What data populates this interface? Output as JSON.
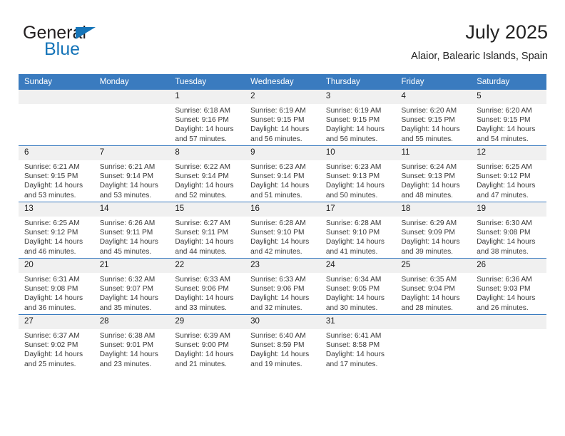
{
  "brand": {
    "word_one": "General",
    "word_two": "Blue"
  },
  "header": {
    "title": "July 2025",
    "subtitle": "Alaior, Balearic Islands, Spain"
  },
  "weekday_headers": [
    "Sunday",
    "Monday",
    "Tuesday",
    "Wednesday",
    "Thursday",
    "Friday",
    "Saturday"
  ],
  "colors": {
    "header_blue": "#3a7bbf",
    "daynum_bg": "#f0f0f0",
    "brand_blue": "#1574b8",
    "text": "#3a3a3a"
  },
  "weeks": [
    [
      {
        "day": "",
        "sunrise": "",
        "sunset": "",
        "daylight_a": "",
        "daylight_b": ""
      },
      {
        "day": "",
        "sunrise": "",
        "sunset": "",
        "daylight_a": "",
        "daylight_b": ""
      },
      {
        "day": "1",
        "sunrise": "Sunrise: 6:18 AM",
        "sunset": "Sunset: 9:16 PM",
        "daylight_a": "Daylight: 14 hours",
        "daylight_b": "and 57 minutes."
      },
      {
        "day": "2",
        "sunrise": "Sunrise: 6:19 AM",
        "sunset": "Sunset: 9:15 PM",
        "daylight_a": "Daylight: 14 hours",
        "daylight_b": "and 56 minutes."
      },
      {
        "day": "3",
        "sunrise": "Sunrise: 6:19 AM",
        "sunset": "Sunset: 9:15 PM",
        "daylight_a": "Daylight: 14 hours",
        "daylight_b": "and 56 minutes."
      },
      {
        "day": "4",
        "sunrise": "Sunrise: 6:20 AM",
        "sunset": "Sunset: 9:15 PM",
        "daylight_a": "Daylight: 14 hours",
        "daylight_b": "and 55 minutes."
      },
      {
        "day": "5",
        "sunrise": "Sunrise: 6:20 AM",
        "sunset": "Sunset: 9:15 PM",
        "daylight_a": "Daylight: 14 hours",
        "daylight_b": "and 54 minutes."
      }
    ],
    [
      {
        "day": "6",
        "sunrise": "Sunrise: 6:21 AM",
        "sunset": "Sunset: 9:15 PM",
        "daylight_a": "Daylight: 14 hours",
        "daylight_b": "and 53 minutes."
      },
      {
        "day": "7",
        "sunrise": "Sunrise: 6:21 AM",
        "sunset": "Sunset: 9:14 PM",
        "daylight_a": "Daylight: 14 hours",
        "daylight_b": "and 53 minutes."
      },
      {
        "day": "8",
        "sunrise": "Sunrise: 6:22 AM",
        "sunset": "Sunset: 9:14 PM",
        "daylight_a": "Daylight: 14 hours",
        "daylight_b": "and 52 minutes."
      },
      {
        "day": "9",
        "sunrise": "Sunrise: 6:23 AM",
        "sunset": "Sunset: 9:14 PM",
        "daylight_a": "Daylight: 14 hours",
        "daylight_b": "and 51 minutes."
      },
      {
        "day": "10",
        "sunrise": "Sunrise: 6:23 AM",
        "sunset": "Sunset: 9:13 PM",
        "daylight_a": "Daylight: 14 hours",
        "daylight_b": "and 50 minutes."
      },
      {
        "day": "11",
        "sunrise": "Sunrise: 6:24 AM",
        "sunset": "Sunset: 9:13 PM",
        "daylight_a": "Daylight: 14 hours",
        "daylight_b": "and 48 minutes."
      },
      {
        "day": "12",
        "sunrise": "Sunrise: 6:25 AM",
        "sunset": "Sunset: 9:12 PM",
        "daylight_a": "Daylight: 14 hours",
        "daylight_b": "and 47 minutes."
      }
    ],
    [
      {
        "day": "13",
        "sunrise": "Sunrise: 6:25 AM",
        "sunset": "Sunset: 9:12 PM",
        "daylight_a": "Daylight: 14 hours",
        "daylight_b": "and 46 minutes."
      },
      {
        "day": "14",
        "sunrise": "Sunrise: 6:26 AM",
        "sunset": "Sunset: 9:11 PM",
        "daylight_a": "Daylight: 14 hours",
        "daylight_b": "and 45 minutes."
      },
      {
        "day": "15",
        "sunrise": "Sunrise: 6:27 AM",
        "sunset": "Sunset: 9:11 PM",
        "daylight_a": "Daylight: 14 hours",
        "daylight_b": "and 44 minutes."
      },
      {
        "day": "16",
        "sunrise": "Sunrise: 6:28 AM",
        "sunset": "Sunset: 9:10 PM",
        "daylight_a": "Daylight: 14 hours",
        "daylight_b": "and 42 minutes."
      },
      {
        "day": "17",
        "sunrise": "Sunrise: 6:28 AM",
        "sunset": "Sunset: 9:10 PM",
        "daylight_a": "Daylight: 14 hours",
        "daylight_b": "and 41 minutes."
      },
      {
        "day": "18",
        "sunrise": "Sunrise: 6:29 AM",
        "sunset": "Sunset: 9:09 PM",
        "daylight_a": "Daylight: 14 hours",
        "daylight_b": "and 39 minutes."
      },
      {
        "day": "19",
        "sunrise": "Sunrise: 6:30 AM",
        "sunset": "Sunset: 9:08 PM",
        "daylight_a": "Daylight: 14 hours",
        "daylight_b": "and 38 minutes."
      }
    ],
    [
      {
        "day": "20",
        "sunrise": "Sunrise: 6:31 AM",
        "sunset": "Sunset: 9:08 PM",
        "daylight_a": "Daylight: 14 hours",
        "daylight_b": "and 36 minutes."
      },
      {
        "day": "21",
        "sunrise": "Sunrise: 6:32 AM",
        "sunset": "Sunset: 9:07 PM",
        "daylight_a": "Daylight: 14 hours",
        "daylight_b": "and 35 minutes."
      },
      {
        "day": "22",
        "sunrise": "Sunrise: 6:33 AM",
        "sunset": "Sunset: 9:06 PM",
        "daylight_a": "Daylight: 14 hours",
        "daylight_b": "and 33 minutes."
      },
      {
        "day": "23",
        "sunrise": "Sunrise: 6:33 AM",
        "sunset": "Sunset: 9:06 PM",
        "daylight_a": "Daylight: 14 hours",
        "daylight_b": "and 32 minutes."
      },
      {
        "day": "24",
        "sunrise": "Sunrise: 6:34 AM",
        "sunset": "Sunset: 9:05 PM",
        "daylight_a": "Daylight: 14 hours",
        "daylight_b": "and 30 minutes."
      },
      {
        "day": "25",
        "sunrise": "Sunrise: 6:35 AM",
        "sunset": "Sunset: 9:04 PM",
        "daylight_a": "Daylight: 14 hours",
        "daylight_b": "and 28 minutes."
      },
      {
        "day": "26",
        "sunrise": "Sunrise: 6:36 AM",
        "sunset": "Sunset: 9:03 PM",
        "daylight_a": "Daylight: 14 hours",
        "daylight_b": "and 26 minutes."
      }
    ],
    [
      {
        "day": "27",
        "sunrise": "Sunrise: 6:37 AM",
        "sunset": "Sunset: 9:02 PM",
        "daylight_a": "Daylight: 14 hours",
        "daylight_b": "and 25 minutes."
      },
      {
        "day": "28",
        "sunrise": "Sunrise: 6:38 AM",
        "sunset": "Sunset: 9:01 PM",
        "daylight_a": "Daylight: 14 hours",
        "daylight_b": "and 23 minutes."
      },
      {
        "day": "29",
        "sunrise": "Sunrise: 6:39 AM",
        "sunset": "Sunset: 9:00 PM",
        "daylight_a": "Daylight: 14 hours",
        "daylight_b": "and 21 minutes."
      },
      {
        "day": "30",
        "sunrise": "Sunrise: 6:40 AM",
        "sunset": "Sunset: 8:59 PM",
        "daylight_a": "Daylight: 14 hours",
        "daylight_b": "and 19 minutes."
      },
      {
        "day": "31",
        "sunrise": "Sunrise: 6:41 AM",
        "sunset": "Sunset: 8:58 PM",
        "daylight_a": "Daylight: 14 hours",
        "daylight_b": "and 17 minutes."
      },
      {
        "day": "",
        "sunrise": "",
        "sunset": "",
        "daylight_a": "",
        "daylight_b": ""
      },
      {
        "day": "",
        "sunrise": "",
        "sunset": "",
        "daylight_a": "",
        "daylight_b": ""
      }
    ]
  ]
}
